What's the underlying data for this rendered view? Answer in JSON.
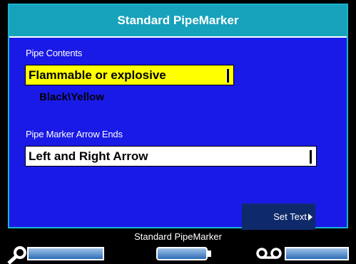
{
  "dialog": {
    "title": "Standard PipeMarker",
    "pipe_contents": {
      "label": "Pipe Contents",
      "value": "Flammable or explosive",
      "color_scheme": "Black\\Yellow"
    },
    "arrow_ends": {
      "label": "Pipe Marker Arrow Ends",
      "value": "Left and Right Arrow"
    },
    "softkey": {
      "label": "Set Text"
    }
  },
  "status": {
    "label": "Standard PipeMarker"
  },
  "bottom_bar": {
    "icons": [
      "search-icon",
      "label-cartridge-icon",
      "tape-reel-icon"
    ]
  },
  "colors": {
    "dialog_bg": "#1a1ae6",
    "title_bg": "#17a2bb",
    "highlight": "#ffff00",
    "softkey_bg": "#0f2a6b"
  }
}
